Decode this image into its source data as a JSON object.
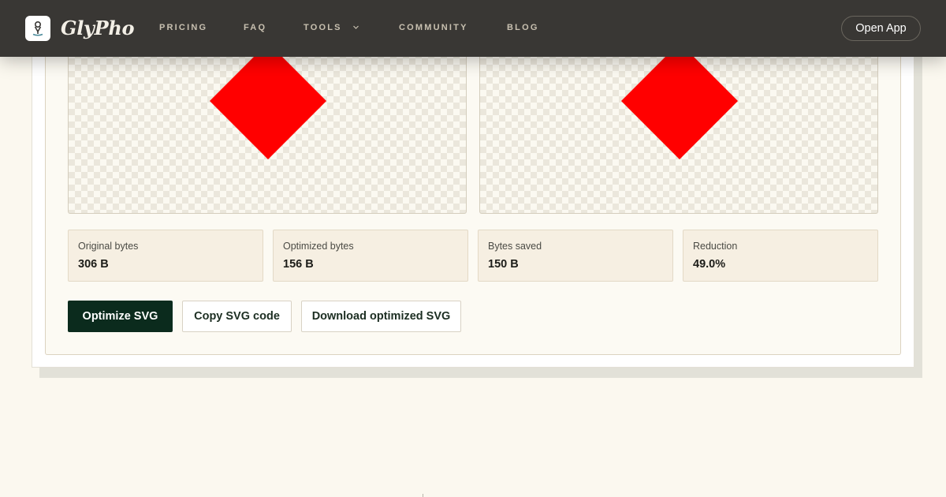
{
  "header": {
    "brand": "GlyPho",
    "nav": [
      {
        "label": "PRICING"
      },
      {
        "label": "FAQ"
      },
      {
        "label": "TOOLS"
      },
      {
        "label": "COMMUNITY"
      },
      {
        "label": "BLOG"
      }
    ],
    "open_app_label": "Open App"
  },
  "previews": {
    "shape_color": "#ff0000",
    "checker_color": "#ebe7dc"
  },
  "stats": [
    {
      "label": "Original bytes",
      "value": "306 B"
    },
    {
      "label": "Optimized bytes",
      "value": "156 B"
    },
    {
      "label": "Bytes saved",
      "value": "150 B"
    },
    {
      "label": "Reduction",
      "value": "49.0%"
    }
  ],
  "actions": {
    "optimize_label": "Optimize SVG",
    "copy_label": "Copy SVG code",
    "download_label": "Download optimized SVG"
  },
  "colors": {
    "primary": "#0b2b1d",
    "header_bg": "#393734",
    "page_bg": "#fbf8ef",
    "stat_bg": "#f6efe2"
  }
}
